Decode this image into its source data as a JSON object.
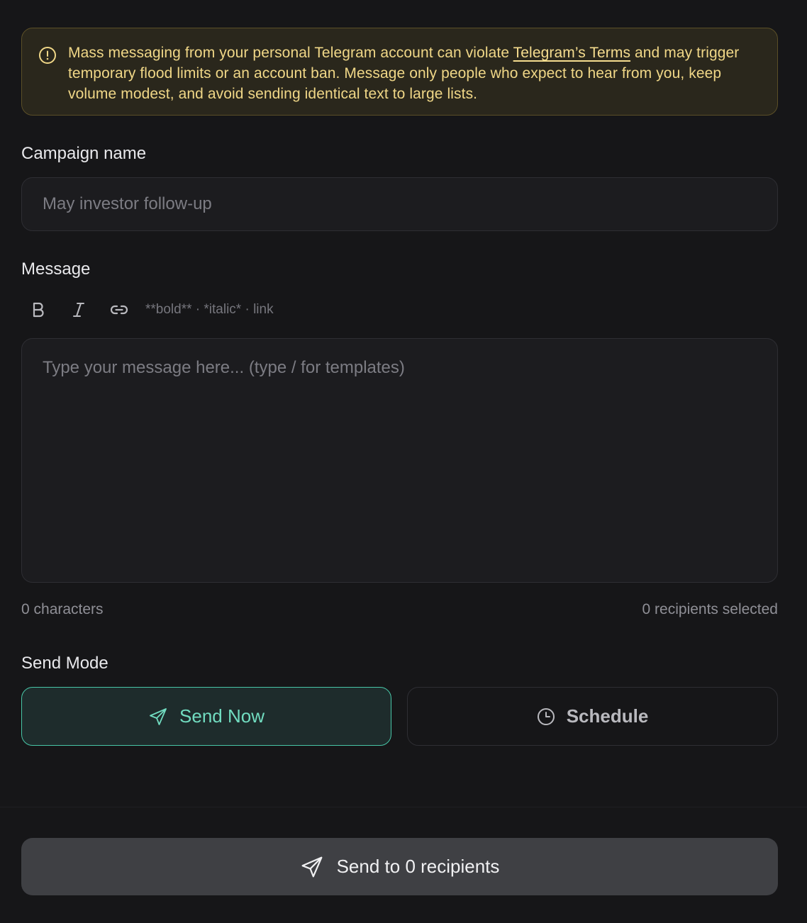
{
  "warning": {
    "text_before": "Mass messaging from your personal Telegram account can violate ",
    "link_text": "Telegram’s Terms",
    "text_after": " and may trigger temporary flood limits or an account ban. Message only people who expect to hear from you, keep volume modest, and avoid sending identical text to large lists.",
    "icon": "alert-circle-icon"
  },
  "campaign": {
    "label": "Campaign name",
    "value": "",
    "placeholder": "May investor follow-up"
  },
  "message": {
    "label": "Message",
    "toolbar": {
      "bold_label": "B",
      "hint": "**bold** · *italic* · link"
    },
    "value": "",
    "placeholder": "Type your message here... (type / for templates)",
    "char_count": "0 characters",
    "recipients": "0 recipients selected"
  },
  "send_mode": {
    "label": "Send Mode",
    "options": [
      {
        "label": "Send Now",
        "icon": "send-icon",
        "selected": true
      },
      {
        "label": "Schedule",
        "icon": "clock-icon",
        "selected": false
      }
    ]
  },
  "submit": {
    "label": "Send to 0 recipients",
    "icon": "send-icon"
  },
  "colors": {
    "background": "#161618",
    "warning_bg": "#2a271c",
    "warning_text": "#f0d787",
    "accent": "#48c6a7",
    "submit_bg": "#3f4044"
  }
}
